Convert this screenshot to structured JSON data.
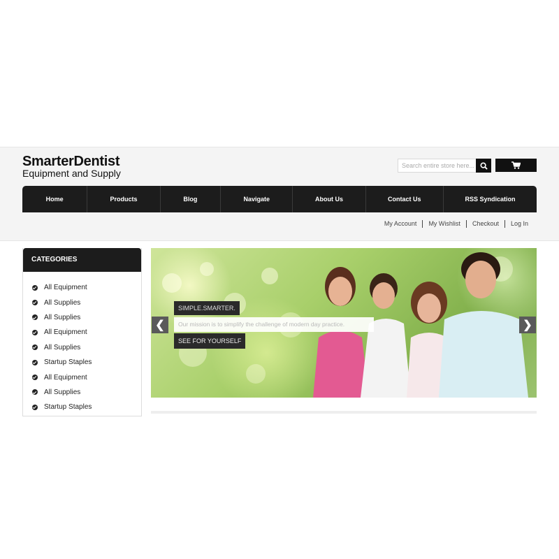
{
  "header": {
    "logo_title": "SmarterDentist",
    "logo_subtitle": "Equipment and Supply",
    "search_placeholder": "Search entire store here...",
    "search_icon": "search-icon",
    "cart_icon": "cart-icon"
  },
  "nav": {
    "items": [
      {
        "label": "Home"
      },
      {
        "label": "Products"
      },
      {
        "label": "Blog"
      },
      {
        "label": "Navigate"
      },
      {
        "label": "About Us"
      },
      {
        "label": "Contact Us"
      },
      {
        "label": "RSS Syndication"
      }
    ]
  },
  "account": {
    "links": [
      {
        "label": "My Account"
      },
      {
        "label": "My Wishlist"
      },
      {
        "label": "Checkout"
      },
      {
        "label": "Log In"
      }
    ]
  },
  "categories": {
    "title": "CATEGORIES",
    "items": [
      {
        "label": "All Equipment"
      },
      {
        "label": "All Supplies"
      },
      {
        "label": "All Supplies"
      },
      {
        "label": "All Equipment"
      },
      {
        "label": "All Supplies"
      },
      {
        "label": "Startup Staples"
      },
      {
        "label": "All Equipment"
      },
      {
        "label": "All Supplies"
      },
      {
        "label": "Startup Staples"
      }
    ]
  },
  "hero": {
    "tagline": "SIMPLE.SMARTER.",
    "mission": "Our mission is to simplify the challenge of modern day practice.",
    "cta": "SEE FOR YOURSELF",
    "prev_icon": "chevron-left-icon",
    "next_icon": "chevron-right-icon"
  },
  "colors": {
    "nav_bg": "#1c1c1c",
    "header_bg": "#f4f4f4",
    "accent": "#111111"
  }
}
